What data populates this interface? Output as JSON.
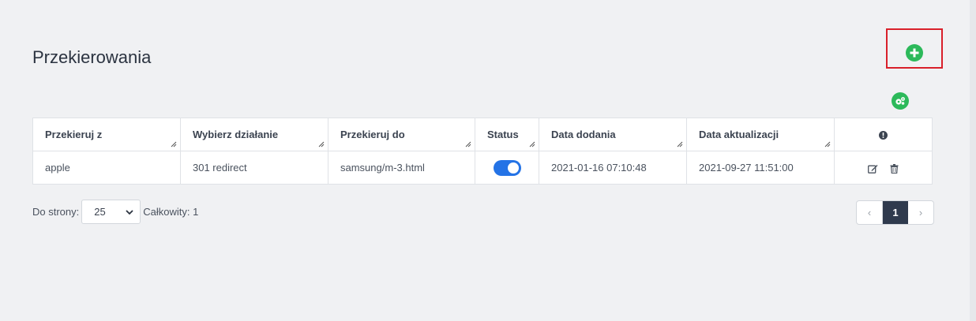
{
  "page": {
    "title": "Przekierowania"
  },
  "toolbar": {
    "add_icon": "plus-circle-icon",
    "settings_icon": "gears-icon",
    "accent": "#2cb95a",
    "highlight": "#d9202a"
  },
  "table": {
    "columns": [
      "Przekieruj z",
      "Wybierz działanie",
      "Przekieruj do",
      "Status",
      "Data dodania",
      "Data aktualizacji"
    ],
    "actions_header_icon": "info-circle-icon",
    "rows": [
      {
        "from": "apple",
        "action": "301 redirect",
        "to": "samsung/m-3.html",
        "status": true,
        "created": "2021-01-16 07:10:48",
        "updated": "2021-09-27 11:51:00"
      }
    ]
  },
  "footer": {
    "per_page_label": "Do strony:",
    "per_page_value": "25",
    "total_label": "Całkowity: 1"
  },
  "pagination": {
    "prev": "‹",
    "current": "1",
    "next": "›"
  }
}
